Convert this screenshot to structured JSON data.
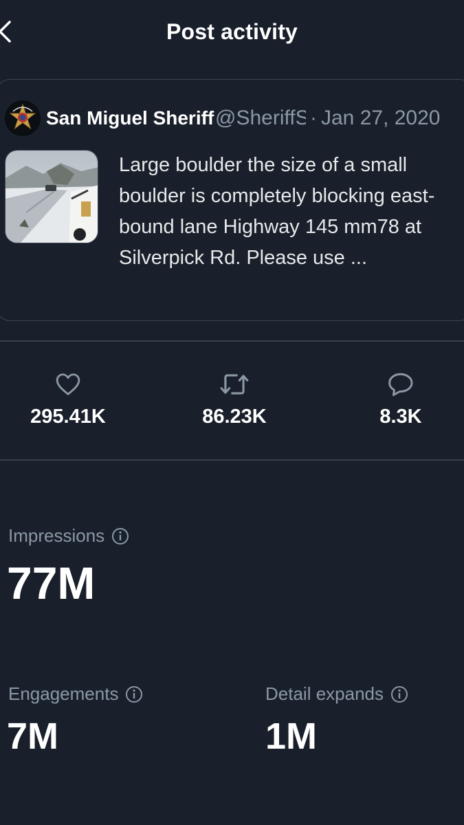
{
  "header": {
    "title": "Post activity",
    "back_icon": "chevron-left-icon"
  },
  "post": {
    "author_name": "San Miguel Sheriff",
    "handle": "@SheriffSMC",
    "separator": "·",
    "date": "Jan 27, 2020",
    "avatar_icon": "sheriff-star-badge",
    "text": "Large boulder the size of a small boulder is completely blocking east-bound lane Highway 145 mm78 at Silverpick Rd. Please use ..."
  },
  "stats": {
    "likes": {
      "icon": "heart-icon",
      "value": "295.41K"
    },
    "reposts": {
      "icon": "repost-icon",
      "value": "86.23K"
    },
    "replies": {
      "icon": "reply-icon",
      "value": "8.3K"
    }
  },
  "metrics": {
    "impressions": {
      "label": "Impressions",
      "value": "77M"
    },
    "engagements": {
      "label": "Engagements",
      "value": "7M"
    },
    "detail_expands": {
      "label": "Detail expands",
      "value": "1M"
    }
  },
  "colors": {
    "background": "#19202b",
    "text_primary": "#ffffff",
    "text_secondary": "#8b98a5",
    "border": "#38414d"
  }
}
